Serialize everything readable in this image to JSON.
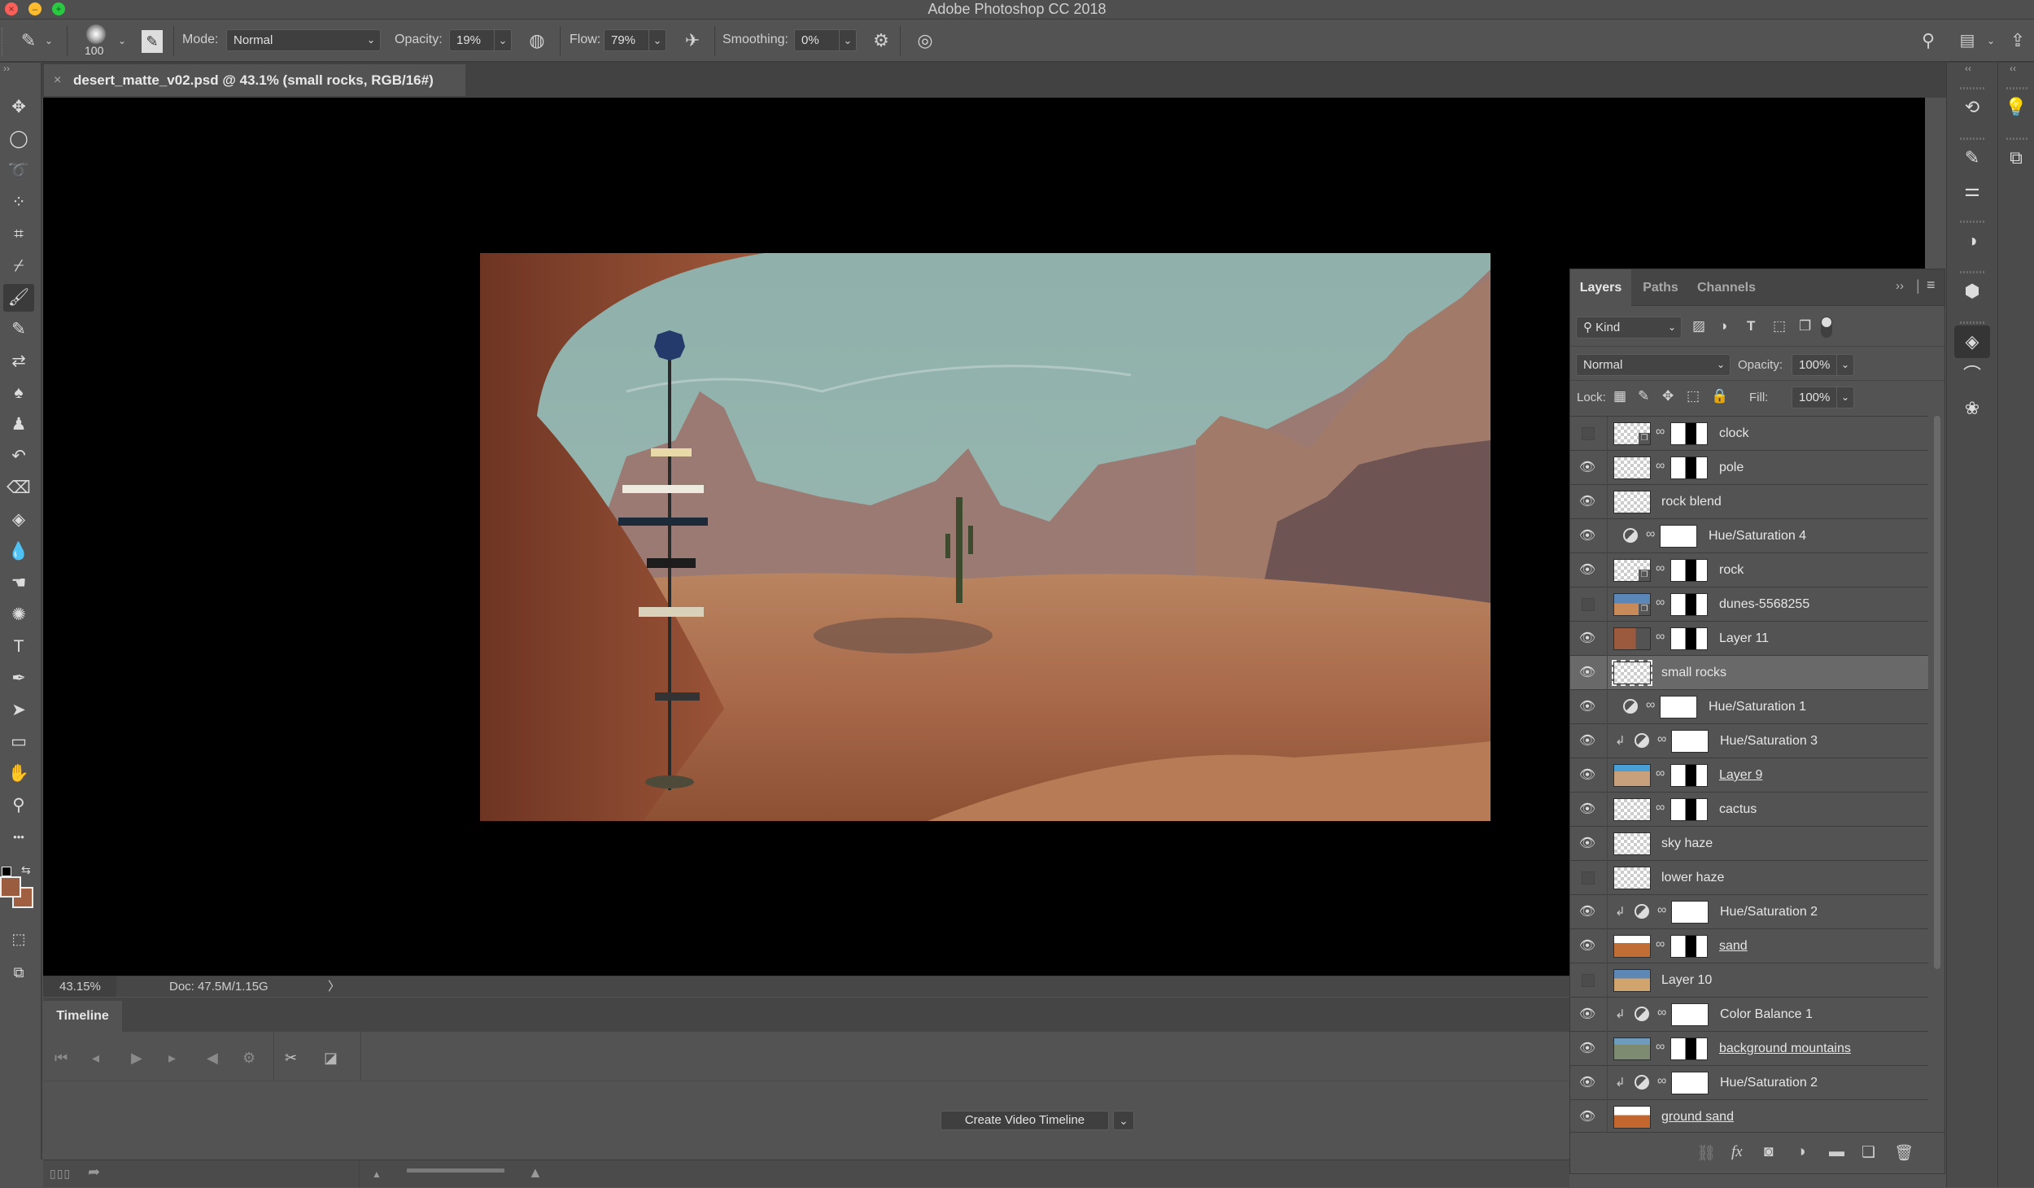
{
  "app": {
    "title": "Adobe Photoshop CC 2018",
    "window_buttons": [
      "close",
      "minimize",
      "maximize"
    ]
  },
  "options_bar": {
    "tool_icon": "brush-icon",
    "brush_size": "100",
    "mode_label": "Mode:",
    "mode_value": "Normal",
    "opacity_label": "Opacity:",
    "opacity_value": "19%",
    "flow_label": "Flow:",
    "flow_value": "79%",
    "smoothing_label": "Smoothing:",
    "smoothing_value": "0%",
    "right_icons": [
      "search-icon",
      "workspace-icon",
      "share-icon"
    ]
  },
  "document": {
    "tab_title": "desert_matte_v02.psd @ 43.1% (small rocks, RGB/16#)",
    "close_glyph": "×"
  },
  "tools": [
    {
      "name": "move-tool",
      "glyph": "✥"
    },
    {
      "name": "elliptical-marquee-tool",
      "glyph": "◯"
    },
    {
      "name": "lasso-tool",
      "glyph": "➰"
    },
    {
      "name": "quick-selection-tool",
      "glyph": "⁘"
    },
    {
      "name": "crop-tool",
      "glyph": "⌗"
    },
    {
      "name": "eyedropper-tool",
      "glyph": "⌿"
    },
    {
      "name": "brush-tool",
      "glyph": "🖌",
      "active": true
    },
    {
      "name": "pencil-tool",
      "glyph": "✎"
    },
    {
      "name": "color-replacement-tool",
      "glyph": "⇄"
    },
    {
      "name": "mixer-brush-tool",
      "glyph": "♠"
    },
    {
      "name": "clone-stamp-tool",
      "glyph": "♟"
    },
    {
      "name": "history-brush-tool",
      "glyph": "↶"
    },
    {
      "name": "eraser-tool",
      "glyph": "⌫"
    },
    {
      "name": "paint-bucket-tool",
      "glyph": "◈"
    },
    {
      "name": "blur-tool",
      "glyph": "💧"
    },
    {
      "name": "dodge-tool",
      "glyph": "☚"
    },
    {
      "name": "sponge-tool",
      "glyph": "✺"
    },
    {
      "name": "type-tool",
      "glyph": "T"
    },
    {
      "name": "pen-tool",
      "glyph": "✒"
    },
    {
      "name": "path-selection-tool",
      "glyph": "➤"
    },
    {
      "name": "rectangle-tool",
      "glyph": "▭"
    },
    {
      "name": "hand-tool",
      "glyph": "✋"
    },
    {
      "name": "zoom-tool",
      "glyph": "⚲"
    },
    {
      "name": "edit-toolbar",
      "glyph": "•••"
    }
  ],
  "colors": {
    "foreground": "#9a5d3f",
    "background": "#a05f40",
    "canvas_bg": "#000000",
    "panel_bg": "#535353",
    "selected_row": "#696969"
  },
  "status_bar": {
    "zoom": "43.15%",
    "doc_info": "Doc: 47.5M/1.15G",
    "arrow": "〉"
  },
  "timeline": {
    "tab_label": "Timeline",
    "create_button": "Create Video Timeline",
    "controls": [
      "first-frame",
      "previous-frame",
      "play",
      "next-frame",
      "audio",
      "settings",
      "split",
      "transition"
    ]
  },
  "layers_panel": {
    "tabs": [
      "Layers",
      "Paths",
      "Channels"
    ],
    "active_tab": "Layers",
    "filter_kind": "Kind",
    "blend_mode": "Normal",
    "opacity_label": "Opacity:",
    "opacity_value": "100%",
    "lock_label": "Lock:",
    "fill_label": "Fill:",
    "fill_value": "100%",
    "layers": [
      {
        "name": "clock",
        "visible": false,
        "type": "smart",
        "mask": true,
        "underline": false
      },
      {
        "name": "pole",
        "visible": true,
        "type": "image",
        "mask": true,
        "underline": false
      },
      {
        "name": "rock blend",
        "visible": true,
        "type": "pixel",
        "mask": false,
        "underline": false
      },
      {
        "name": "Hue/Saturation 4",
        "visible": true,
        "type": "adjustment",
        "clipped": false,
        "underline": false
      },
      {
        "name": "rock",
        "visible": true,
        "type": "smart",
        "mask": true,
        "underline": false
      },
      {
        "name": "dunes-5568255",
        "visible": false,
        "type": "smart",
        "mask": true,
        "underline": false
      },
      {
        "name": "Layer 11",
        "visible": true,
        "type": "image",
        "mask": true,
        "underline": false
      },
      {
        "name": "small rocks",
        "visible": true,
        "type": "pixel",
        "mask": false,
        "selected": true,
        "underline": false
      },
      {
        "name": "Hue/Saturation 1",
        "visible": true,
        "type": "adjustment",
        "clipped": false,
        "underline": false
      },
      {
        "name": "Hue/Saturation 3",
        "visible": true,
        "type": "adjustment",
        "clipped": true,
        "underline": false
      },
      {
        "name": "Layer 9",
        "visible": true,
        "type": "image",
        "mask": true,
        "underline": true
      },
      {
        "name": "cactus",
        "visible": true,
        "type": "pixel",
        "mask": true,
        "underline": false
      },
      {
        "name": "sky haze",
        "visible": true,
        "type": "pixel",
        "mask": false,
        "underline": false
      },
      {
        "name": "lower haze",
        "visible": false,
        "type": "pixel",
        "mask": false,
        "underline": false
      },
      {
        "name": "Hue/Saturation 2",
        "visible": true,
        "type": "adjustment",
        "clipped": true,
        "underline": false
      },
      {
        "name": "sand",
        "visible": true,
        "type": "image",
        "mask": true,
        "underline": true
      },
      {
        "name": "Layer 10",
        "visible": false,
        "type": "image",
        "mask": false,
        "underline": false
      },
      {
        "name": "Color Balance 1",
        "visible": true,
        "type": "adjustment",
        "clipped": true,
        "underline": false
      },
      {
        "name": "background mountains",
        "visible": true,
        "type": "image",
        "mask": true,
        "underline": true
      },
      {
        "name": "Hue/Saturation 2",
        "visible": true,
        "type": "adjustment",
        "clipped": true,
        "underline": false
      },
      {
        "name": "ground sand",
        "visible": true,
        "type": "image",
        "mask": false,
        "underline": true
      }
    ],
    "footer_icons": [
      "link-layers-icon",
      "fx-icon",
      "add-mask-icon",
      "new-adjustment-icon",
      "new-group-icon",
      "new-layer-icon",
      "delete-layer-icon"
    ]
  },
  "right_strip": {
    "icons": [
      "history-icon",
      "brush-settings-icon",
      "brush-presets-icon",
      "adjustments-icon",
      "libraries-icon",
      "layers-icon",
      "paths-icon",
      "channels-icon"
    ],
    "secondary_icons": [
      "learn-icon",
      "book-icon"
    ]
  },
  "glyphs": {
    "eye": "👁",
    "link": "∞",
    "clip": "↲",
    "caret": "⌄",
    "collapse": "‹‹",
    "expand": "››",
    "menu": "≡"
  }
}
